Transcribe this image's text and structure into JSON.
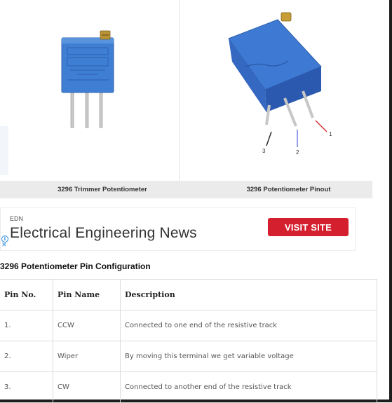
{
  "images": {
    "left": {
      "label": "BOURNS 3296 trimmer potentiometer photo",
      "caption": "3296 Trimmer Potentiometer"
    },
    "right": {
      "label": "3296 potentiometer pinout photo",
      "caption": "3296 Potentiometer Pinout",
      "pin_labels": [
        "3",
        "2",
        "1"
      ]
    }
  },
  "ad": {
    "brand": "EDN",
    "title": "Electrical Engineering News",
    "button": "VISIT SITE",
    "info_icon": "info-icon",
    "close_icon": "close-icon",
    "button_color": "#d41f2e"
  },
  "section": {
    "heading": "3296 Potentiometer Pin Configuration"
  },
  "table": {
    "headers": [
      "Pin No.",
      "Pin Name",
      "Description"
    ],
    "rows": [
      [
        "1.",
        "CCW",
        "Connected to one end of the resistive track"
      ],
      [
        "2.",
        "Wiper",
        "By moving this terminal we get variable voltage"
      ],
      [
        "3.",
        "CW",
        "Connected to another end of the resistive track"
      ]
    ]
  },
  "colors": {
    "component_blue": "#3d78d0",
    "caption_bg": "#ebebeb",
    "pin_3_line": "#222222",
    "pin_2_line": "#6a78e0",
    "pin_1_line": "#d43030"
  }
}
